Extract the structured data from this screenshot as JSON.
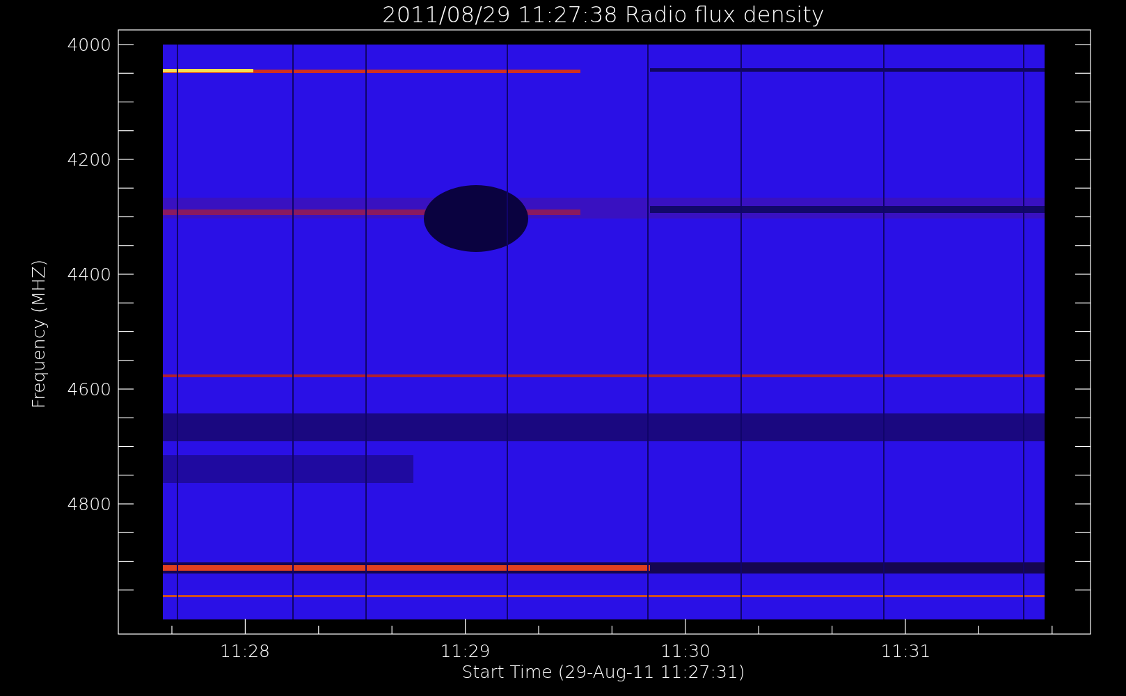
{
  "title": "2011/08/29 11:27:38 Radio flux density",
  "y_axis": {
    "label": "Frequency (MHZ)",
    "ticks": [
      "4000",
      "4200",
      "4400",
      "4600",
      "4800"
    ]
  },
  "x_axis": {
    "label": "Start Time (29-Aug-11 11:27:31)",
    "ticks": [
      "11:28",
      "11:29",
      "11:30",
      "11:31"
    ]
  }
}
